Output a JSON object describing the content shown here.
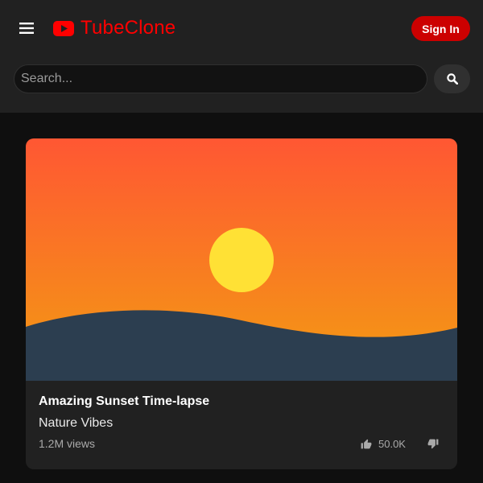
{
  "header": {
    "brand_name": "TubeClone",
    "signin_label": "Sign In",
    "brand_color": "#ff0000",
    "signin_color": "#cc0000"
  },
  "search": {
    "placeholder": "Search...",
    "value": ""
  },
  "icons": {
    "menu": "hamburger-icon",
    "logo": "play-logo-icon",
    "search": "search-icon",
    "like": "thumbs-up-icon",
    "dislike": "thumbs-down-icon"
  },
  "video": {
    "title": "Amazing Sunset Time-lapse",
    "channel": "Nature Vibes",
    "views": "1.2M views",
    "likes": "50.0K",
    "thumbnail_colors": {
      "sky_top": "#ff5733",
      "sky_bottom": "#f39c12",
      "sun": "#ffe135",
      "hill": "#2c3e50"
    }
  }
}
